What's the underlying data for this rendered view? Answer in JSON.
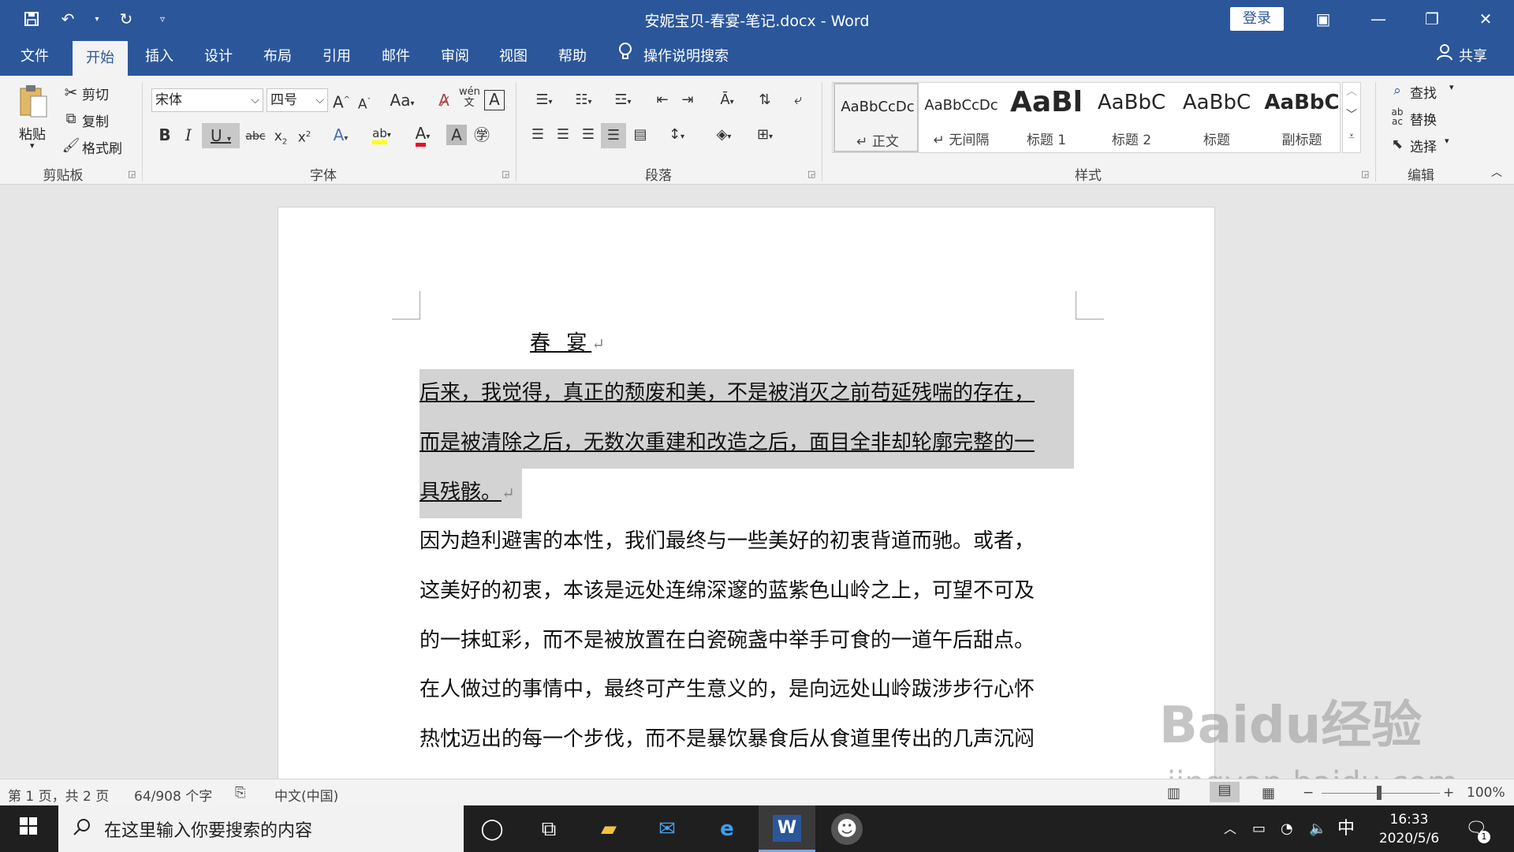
{
  "window": {
    "title": "安妮宝贝-春宴-笔记.docx  -  Word",
    "login": "登录"
  },
  "tabs": [
    "文件",
    "开始",
    "插入",
    "设计",
    "布局",
    "引用",
    "邮件",
    "审阅",
    "视图",
    "帮助"
  ],
  "tell_me": "操作说明搜索",
  "share": "共享",
  "ribbon": {
    "clipboard": {
      "label": "剪贴板",
      "paste": "粘贴",
      "cut": "剪切",
      "copy": "复制",
      "format_painter": "格式刷"
    },
    "font": {
      "label": "字体",
      "font_name": "宋体",
      "font_size": "四号"
    },
    "paragraph": {
      "label": "段落"
    },
    "styles": {
      "label": "样式",
      "items": [
        {
          "sample": "AaBbCcDc",
          "name": "↵ 正文"
        },
        {
          "sample": "AaBbCcDc",
          "name": "↵ 无间隔"
        },
        {
          "sample": "AaBl",
          "name": "标题 1"
        },
        {
          "sample": "AaBbC",
          "name": "标题 2"
        },
        {
          "sample": "AaBbC",
          "name": "标题"
        },
        {
          "sample": "AaBbC",
          "name": "副标题"
        }
      ]
    },
    "editing": {
      "label": "编辑",
      "find": "查找",
      "replace": "替换",
      "select": "选择"
    }
  },
  "document": {
    "heading": "春  宴",
    "lines": [
      "后来，我觉得，真正的颓废和美，不是被消灭之前苟延残喘的存在，",
      "而是被清除之后，无数次重建和改造之后，面目全非却轮廓完整的一",
      "具残骸。",
      "因为趋利避害的本性，我们最终与一些美好的初衷背道而驰。或者，",
      "这美好的初衷，本该是远处连绵深邃的蓝紫色山岭之上，可望不可及",
      "的一抹虹彩，而不是被放置在白瓷碗盏中举手可食的一道午后甜点。",
      "在人做过的事情中，最终可产生意义的，是向远处山岭跋涉步行心怀",
      "热忱迈出的每一个步伐，而不是暴饮暴食后从食道里传出的几声沉闷"
    ],
    "selected_lines": 3
  },
  "status": {
    "page": "第 1 页，共 2 页",
    "words": "64/908 个字",
    "language": "中文(中国)",
    "zoom": "100%"
  },
  "taskbar": {
    "search_placeholder": "在这里输入你要搜索的内容",
    "time": "16:33",
    "date": "2020/5/6",
    "ime": "中",
    "notifications": "1"
  },
  "watermark": {
    "main": "Baidu经验",
    "sub": "jingyan.baidu.com"
  }
}
